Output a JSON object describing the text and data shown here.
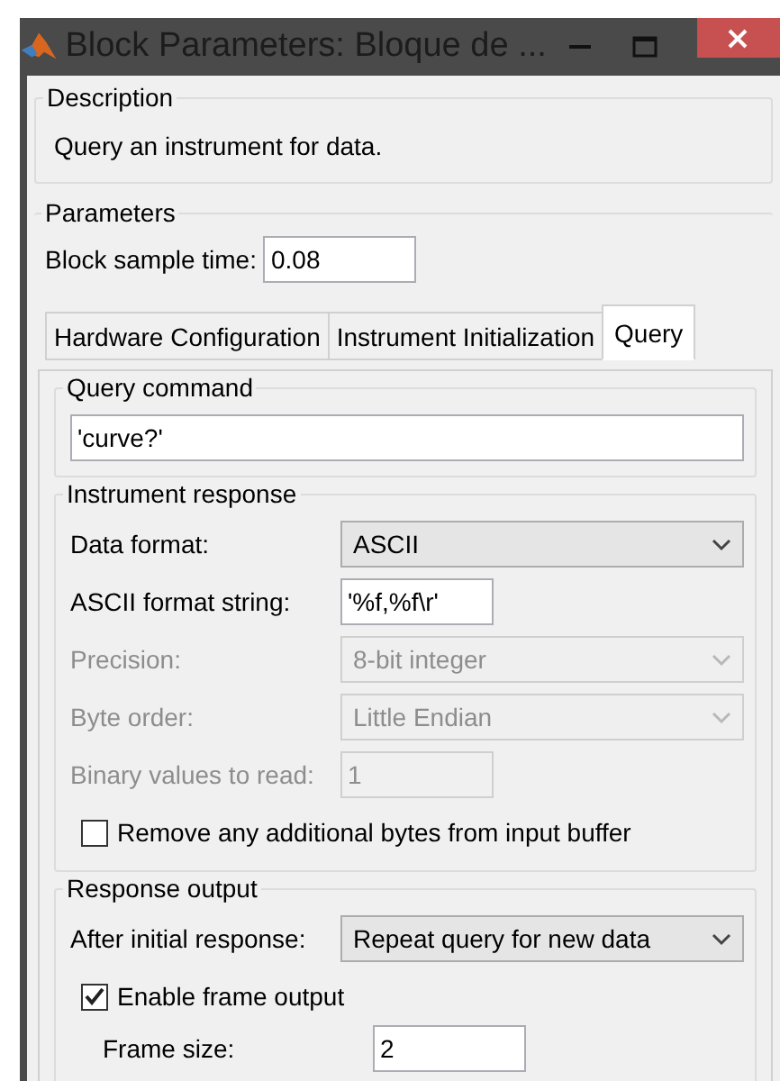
{
  "window": {
    "title": "Block Parameters: Bloque de ..."
  },
  "description": {
    "heading": "Description",
    "text": "Query an instrument for data."
  },
  "parameters": {
    "heading": "Parameters",
    "fields": [
      {
        "kind": "input",
        "label": "Block sample time:",
        "value": "0.08",
        "disabled": false
      }
    ],
    "tabs": [
      {
        "label": "Hardware Configuration",
        "selected": false
      },
      {
        "label": "Instrument Initialization",
        "selected": false
      },
      {
        "label": "Query",
        "selected": true
      }
    ],
    "groups": [
      {
        "heading": "Query command",
        "fields": [
          {
            "kind": "wide_input",
            "value": "'curve?'",
            "disabled": false
          }
        ]
      },
      {
        "heading": "Instrument response",
        "fields": [
          {
            "kind": "select",
            "label": "Data format:",
            "value": "ASCII",
            "disabled": false
          },
          {
            "kind": "input",
            "label": "ASCII format string:",
            "value": "'%f,%f\\r'",
            "disabled": false
          },
          {
            "kind": "select",
            "label": "Precision:",
            "value": "8-bit integer",
            "disabled": true
          },
          {
            "kind": "select",
            "label": "Byte order:",
            "value": "Little Endian",
            "disabled": true
          },
          {
            "kind": "input",
            "label": "Binary values to read:",
            "value": "1",
            "disabled": true
          },
          {
            "kind": "checkbox",
            "label": "Remove any additional bytes from input buffer",
            "checked": false
          }
        ]
      },
      {
        "heading": "Response output",
        "fields": [
          {
            "kind": "select",
            "label": "After initial response:",
            "value": "Repeat query for new data",
            "disabled": false
          },
          {
            "kind": "checkbox",
            "label": "Enable frame output",
            "checked": true,
            "children": [
              {
                "kind": "input",
                "label": "Frame size:",
                "value": "2",
                "disabled": false
              }
            ]
          }
        ]
      }
    ]
  }
}
